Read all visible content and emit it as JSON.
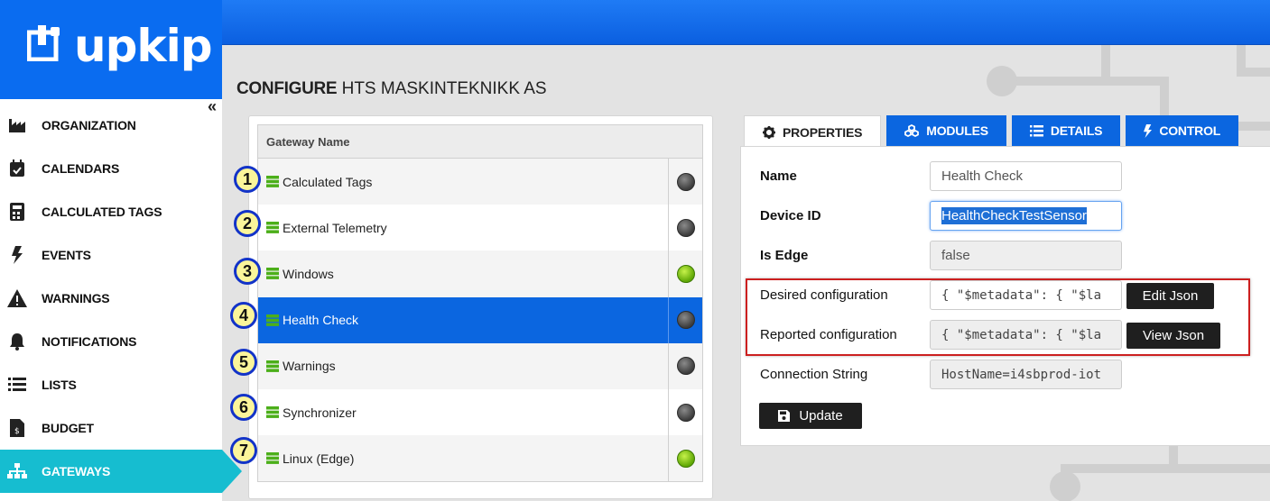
{
  "brand": {
    "name": "upkip",
    "primary_color": "#0a6cf0",
    "accent_color": "#16bdd0"
  },
  "sidebar": {
    "collapse_icon": "double-chevron-left-icon",
    "items": [
      {
        "label": "ORGANIZATION",
        "icon": "factory-icon"
      },
      {
        "label": "CALENDARS",
        "icon": "calendar-check-icon"
      },
      {
        "label": "CALCULATED TAGS",
        "icon": "calculator-icon"
      },
      {
        "label": "EVENTS",
        "icon": "bolt-icon"
      },
      {
        "label": "WARNINGS",
        "icon": "warning-icon"
      },
      {
        "label": "NOTIFICATIONS",
        "icon": "bell-icon"
      },
      {
        "label": "LISTS",
        "icon": "list-icon"
      },
      {
        "label": "BUDGET",
        "icon": "invoice-icon"
      },
      {
        "label": "GATEWAYS",
        "icon": "sitemap-icon",
        "active": true
      }
    ]
  },
  "page": {
    "title_bold": "CONFIGURE",
    "title_rest": " HTS MASKINTEKNIKK AS"
  },
  "gateways": {
    "header": "Gateway Name",
    "rows": [
      {
        "badge": "1",
        "name": "Calculated Tags",
        "online": false
      },
      {
        "badge": "2",
        "name": "External Telemetry",
        "online": false
      },
      {
        "badge": "3",
        "name": "Windows",
        "online": true
      },
      {
        "badge": "4",
        "name": "Health Check",
        "online": false,
        "selected": true
      },
      {
        "badge": "5",
        "name": "Warnings",
        "online": false
      },
      {
        "badge": "6",
        "name": "Synchronizer",
        "online": false
      },
      {
        "badge": "7",
        "name": "Linux (Edge)",
        "online": true
      }
    ]
  },
  "tabs": [
    {
      "label": "PROPERTIES",
      "icon": "gear-icon",
      "active": true
    },
    {
      "label": "MODULES",
      "icon": "cubes-icon"
    },
    {
      "label": "DETAILS",
      "icon": "list-icon"
    },
    {
      "label": "CONTROL",
      "icon": "bolt-icon"
    }
  ],
  "properties": {
    "name_label": "Name",
    "name_value": "Health Check",
    "device_id_label": "Device ID",
    "device_id_value": "HealthCheckTestSensor",
    "is_edge_label": "Is Edge",
    "is_edge_value": "false",
    "desired_label": "Desired configuration",
    "desired_value": "{ \"$metadata\": {  \"$la",
    "edit_json": "Edit Json",
    "reported_label": "Reported configuration",
    "reported_value": "{ \"$metadata\": {  \"$la",
    "view_json": "View Json",
    "conn_label": "Connection String",
    "conn_value": "HostName=i4sbprod-iot",
    "update": "Update",
    "update_icon": "save-icon"
  }
}
